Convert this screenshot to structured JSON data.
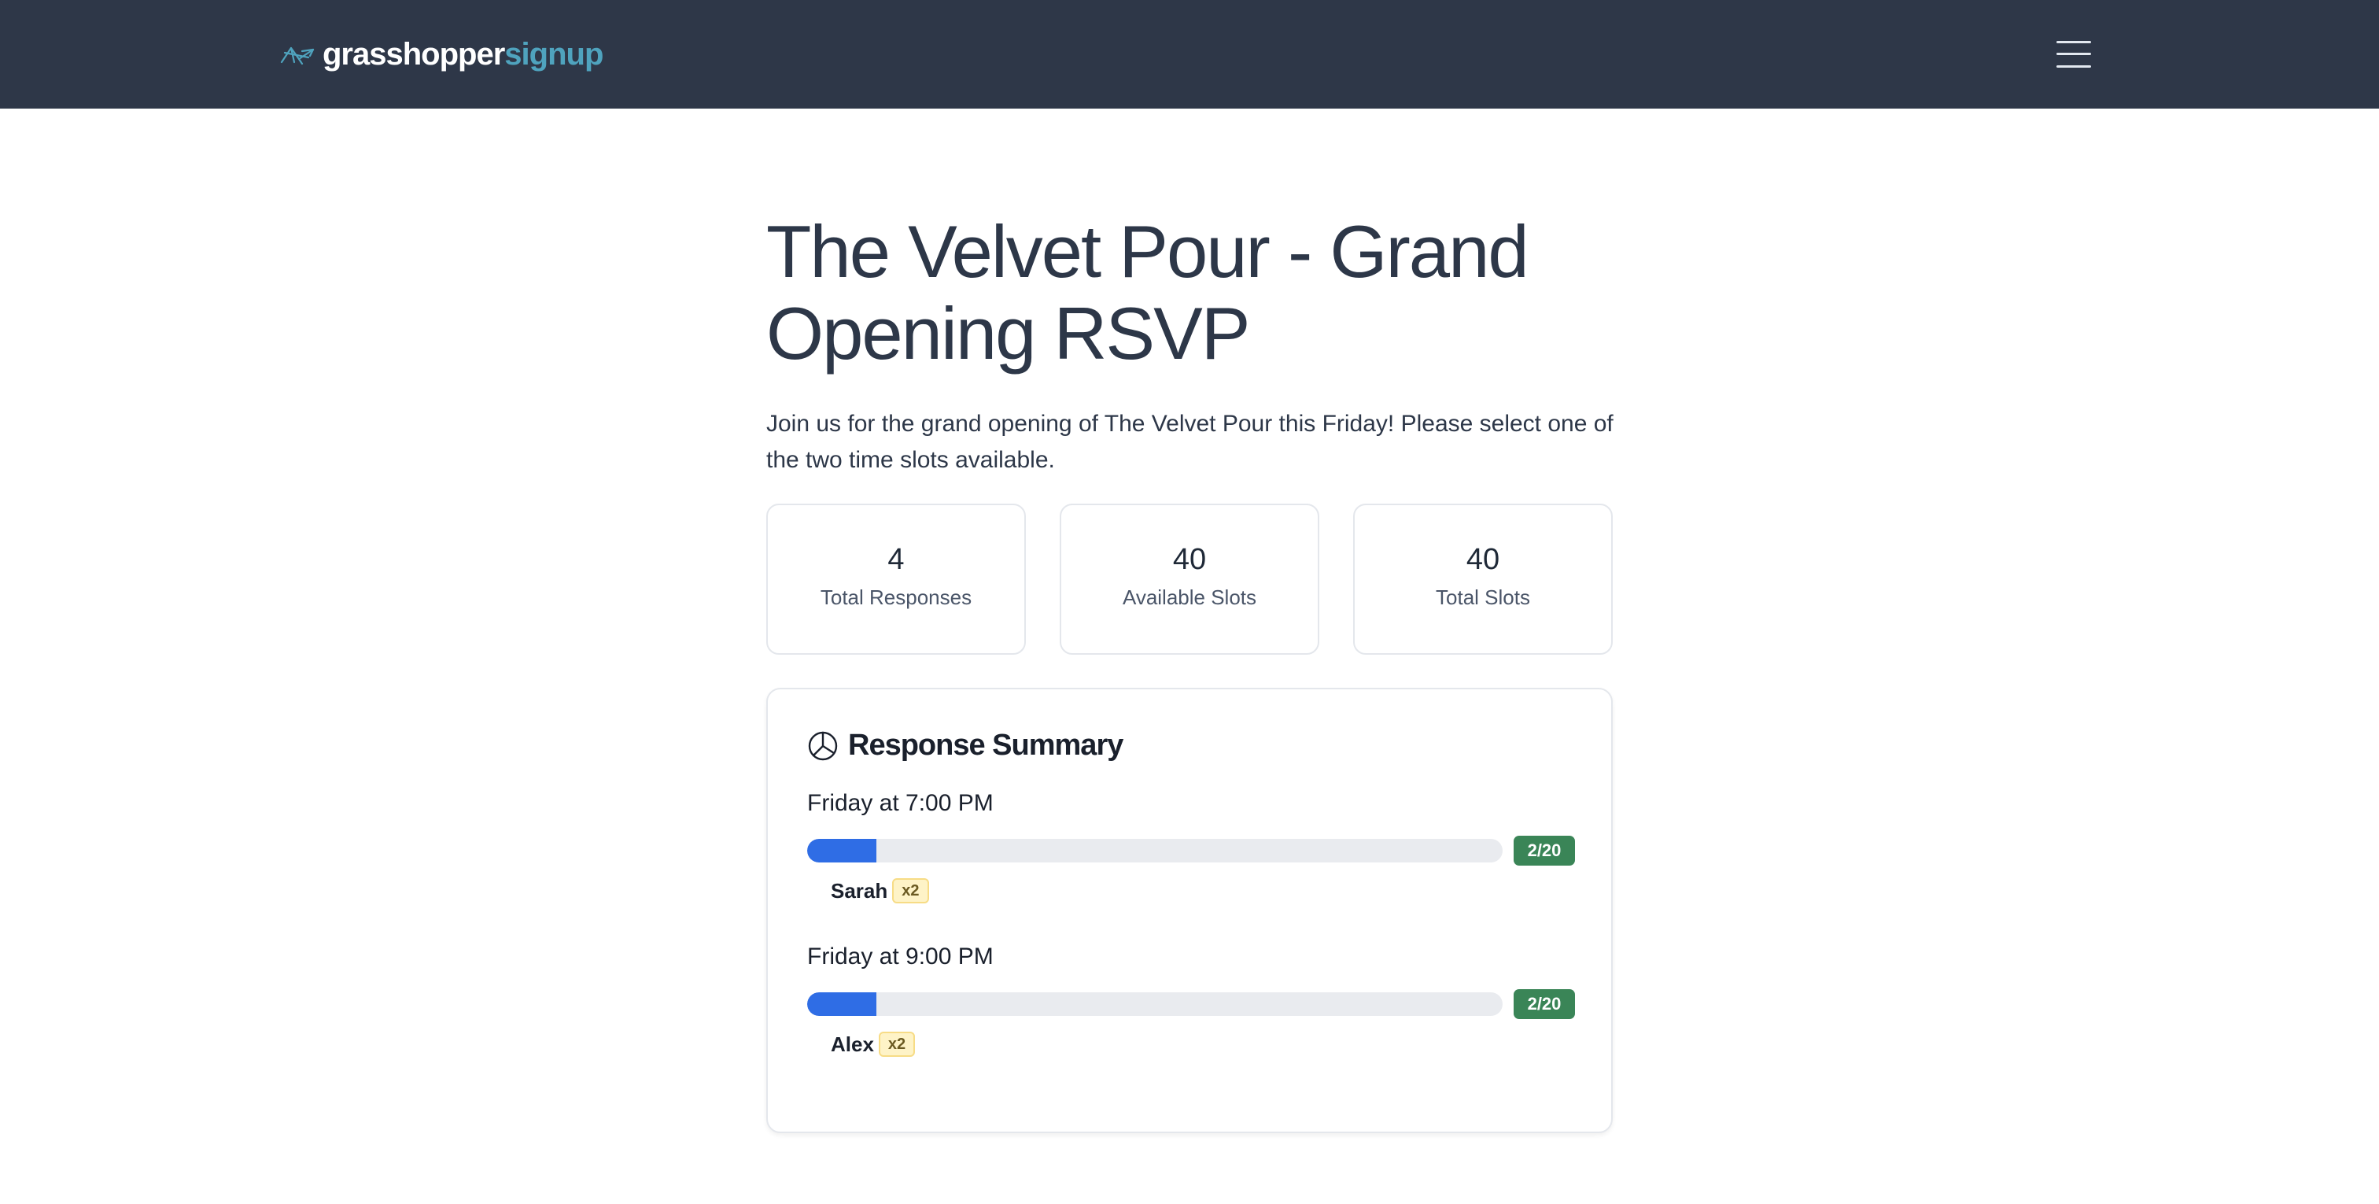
{
  "navbar": {
    "logo_primary": "grasshopper",
    "logo_accent": "signup",
    "menu_icon": "hamburger-menu-icon"
  },
  "page": {
    "title": "The Velvet Pour - Grand Opening RSVP",
    "description": "Join us for the grand opening of The Velvet Pour this Friday! Please select one of the two time slots available."
  },
  "stats": [
    {
      "value": "4",
      "label": "Total Responses"
    },
    {
      "value": "40",
      "label": "Available Slots"
    },
    {
      "value": "40",
      "label": "Total Slots"
    }
  ],
  "summary": {
    "icon": "pie-chart-icon",
    "title": "Response Summary",
    "slots": [
      {
        "label": "Friday at 7:00 PM",
        "filled": 2,
        "capacity": 20,
        "count_text": "2/20",
        "attendees": [
          {
            "name": "Sarah",
            "qty": "x2"
          }
        ]
      },
      {
        "label": "Friday at 9:00 PM",
        "filled": 2,
        "capacity": 20,
        "count_text": "2/20",
        "attendees": [
          {
            "name": "Alex",
            "qty": "x2"
          }
        ]
      }
    ]
  },
  "colors": {
    "navbar_bg": "#2e3748",
    "brand_accent": "#4fa3be",
    "progress_fill": "#2f6de5",
    "count_badge": "#3a8557",
    "qty_badge_bg": "#fef3c7"
  }
}
